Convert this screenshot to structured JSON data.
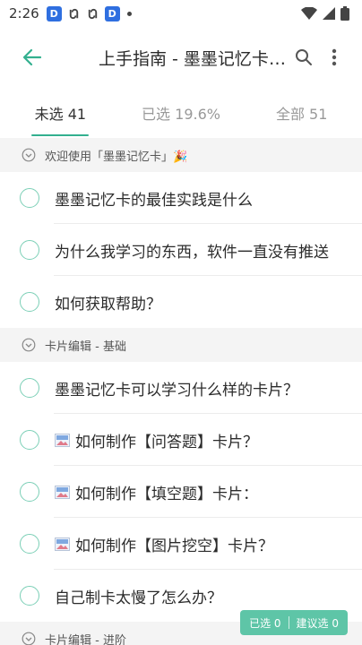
{
  "status_bar": {
    "time": "2:26",
    "badge_letter": "D"
  },
  "app_bar": {
    "title": "上手指南 - 墨墨记忆卡的最佳实践"
  },
  "tabs": [
    {
      "label": "未选 41",
      "active": true
    },
    {
      "label": "已选 19.6%",
      "active": false
    },
    {
      "label": "全部 51",
      "active": false
    }
  ],
  "sections": [
    {
      "title": "欢迎使用「墨墨记忆卡」🎉",
      "items": [
        {
          "text": "墨墨记忆卡的最佳实践是什么",
          "has_image": false
        },
        {
          "text": "为什么我学习的东西，软件一直没有推送",
          "has_image": false
        },
        {
          "text": "如何获取帮助？",
          "has_image": false
        }
      ]
    },
    {
      "title": "卡片编辑 - 基础",
      "items": [
        {
          "text": "墨墨记忆卡可以学习什么样的卡片？",
          "has_image": false
        },
        {
          "text": "如何制作【问答题】卡片？",
          "has_image": true
        },
        {
          "text": "如何制作【填空题】卡片：",
          "has_image": true
        },
        {
          "text": "如何制作【图片挖空】卡片？",
          "has_image": true
        },
        {
          "text": "自己制卡太慢了怎么办？",
          "has_image": false
        }
      ]
    },
    {
      "title": "卡片编辑 - 进阶",
      "items": []
    }
  ],
  "bottom_bar": {
    "selected_label": "已选 0",
    "suggested_label": "建议选 0"
  },
  "colors": {
    "accent": "#33b08f",
    "pill": "#5ec5a7",
    "section_bg": "#f4f4f4"
  }
}
